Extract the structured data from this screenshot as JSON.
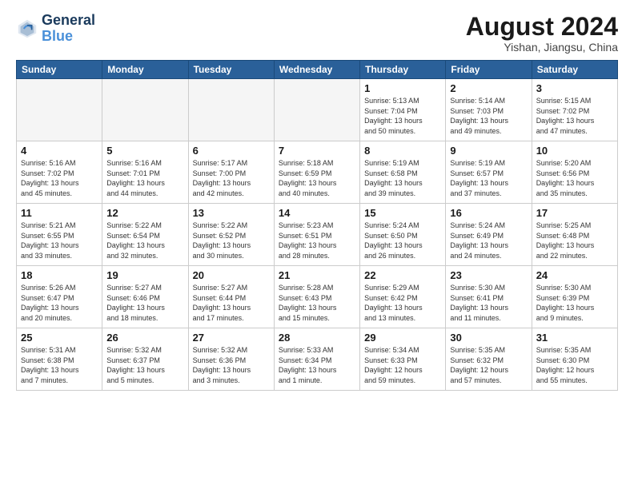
{
  "header": {
    "logo_line1": "General",
    "logo_line2": "Blue",
    "title": "August 2024",
    "location": "Yishan, Jiangsu, China"
  },
  "weekdays": [
    "Sunday",
    "Monday",
    "Tuesday",
    "Wednesday",
    "Thursday",
    "Friday",
    "Saturday"
  ],
  "weeks": [
    [
      {
        "day": "",
        "info": ""
      },
      {
        "day": "",
        "info": ""
      },
      {
        "day": "",
        "info": ""
      },
      {
        "day": "",
        "info": ""
      },
      {
        "day": "1",
        "info": "Sunrise: 5:13 AM\nSunset: 7:04 PM\nDaylight: 13 hours\nand 50 minutes."
      },
      {
        "day": "2",
        "info": "Sunrise: 5:14 AM\nSunset: 7:03 PM\nDaylight: 13 hours\nand 49 minutes."
      },
      {
        "day": "3",
        "info": "Sunrise: 5:15 AM\nSunset: 7:02 PM\nDaylight: 13 hours\nand 47 minutes."
      }
    ],
    [
      {
        "day": "4",
        "info": "Sunrise: 5:16 AM\nSunset: 7:02 PM\nDaylight: 13 hours\nand 45 minutes."
      },
      {
        "day": "5",
        "info": "Sunrise: 5:16 AM\nSunset: 7:01 PM\nDaylight: 13 hours\nand 44 minutes."
      },
      {
        "day": "6",
        "info": "Sunrise: 5:17 AM\nSunset: 7:00 PM\nDaylight: 13 hours\nand 42 minutes."
      },
      {
        "day": "7",
        "info": "Sunrise: 5:18 AM\nSunset: 6:59 PM\nDaylight: 13 hours\nand 40 minutes."
      },
      {
        "day": "8",
        "info": "Sunrise: 5:19 AM\nSunset: 6:58 PM\nDaylight: 13 hours\nand 39 minutes."
      },
      {
        "day": "9",
        "info": "Sunrise: 5:19 AM\nSunset: 6:57 PM\nDaylight: 13 hours\nand 37 minutes."
      },
      {
        "day": "10",
        "info": "Sunrise: 5:20 AM\nSunset: 6:56 PM\nDaylight: 13 hours\nand 35 minutes."
      }
    ],
    [
      {
        "day": "11",
        "info": "Sunrise: 5:21 AM\nSunset: 6:55 PM\nDaylight: 13 hours\nand 33 minutes."
      },
      {
        "day": "12",
        "info": "Sunrise: 5:22 AM\nSunset: 6:54 PM\nDaylight: 13 hours\nand 32 minutes."
      },
      {
        "day": "13",
        "info": "Sunrise: 5:22 AM\nSunset: 6:52 PM\nDaylight: 13 hours\nand 30 minutes."
      },
      {
        "day": "14",
        "info": "Sunrise: 5:23 AM\nSunset: 6:51 PM\nDaylight: 13 hours\nand 28 minutes."
      },
      {
        "day": "15",
        "info": "Sunrise: 5:24 AM\nSunset: 6:50 PM\nDaylight: 13 hours\nand 26 minutes."
      },
      {
        "day": "16",
        "info": "Sunrise: 5:24 AM\nSunset: 6:49 PM\nDaylight: 13 hours\nand 24 minutes."
      },
      {
        "day": "17",
        "info": "Sunrise: 5:25 AM\nSunset: 6:48 PM\nDaylight: 13 hours\nand 22 minutes."
      }
    ],
    [
      {
        "day": "18",
        "info": "Sunrise: 5:26 AM\nSunset: 6:47 PM\nDaylight: 13 hours\nand 20 minutes."
      },
      {
        "day": "19",
        "info": "Sunrise: 5:27 AM\nSunset: 6:46 PM\nDaylight: 13 hours\nand 18 minutes."
      },
      {
        "day": "20",
        "info": "Sunrise: 5:27 AM\nSunset: 6:44 PM\nDaylight: 13 hours\nand 17 minutes."
      },
      {
        "day": "21",
        "info": "Sunrise: 5:28 AM\nSunset: 6:43 PM\nDaylight: 13 hours\nand 15 minutes."
      },
      {
        "day": "22",
        "info": "Sunrise: 5:29 AM\nSunset: 6:42 PM\nDaylight: 13 hours\nand 13 minutes."
      },
      {
        "day": "23",
        "info": "Sunrise: 5:30 AM\nSunset: 6:41 PM\nDaylight: 13 hours\nand 11 minutes."
      },
      {
        "day": "24",
        "info": "Sunrise: 5:30 AM\nSunset: 6:39 PM\nDaylight: 13 hours\nand 9 minutes."
      }
    ],
    [
      {
        "day": "25",
        "info": "Sunrise: 5:31 AM\nSunset: 6:38 PM\nDaylight: 13 hours\nand 7 minutes."
      },
      {
        "day": "26",
        "info": "Sunrise: 5:32 AM\nSunset: 6:37 PM\nDaylight: 13 hours\nand 5 minutes."
      },
      {
        "day": "27",
        "info": "Sunrise: 5:32 AM\nSunset: 6:36 PM\nDaylight: 13 hours\nand 3 minutes."
      },
      {
        "day": "28",
        "info": "Sunrise: 5:33 AM\nSunset: 6:34 PM\nDaylight: 13 hours\nand 1 minute."
      },
      {
        "day": "29",
        "info": "Sunrise: 5:34 AM\nSunset: 6:33 PM\nDaylight: 12 hours\nand 59 minutes."
      },
      {
        "day": "30",
        "info": "Sunrise: 5:35 AM\nSunset: 6:32 PM\nDaylight: 12 hours\nand 57 minutes."
      },
      {
        "day": "31",
        "info": "Sunrise: 5:35 AM\nSunset: 6:30 PM\nDaylight: 12 hours\nand 55 minutes."
      }
    ]
  ]
}
